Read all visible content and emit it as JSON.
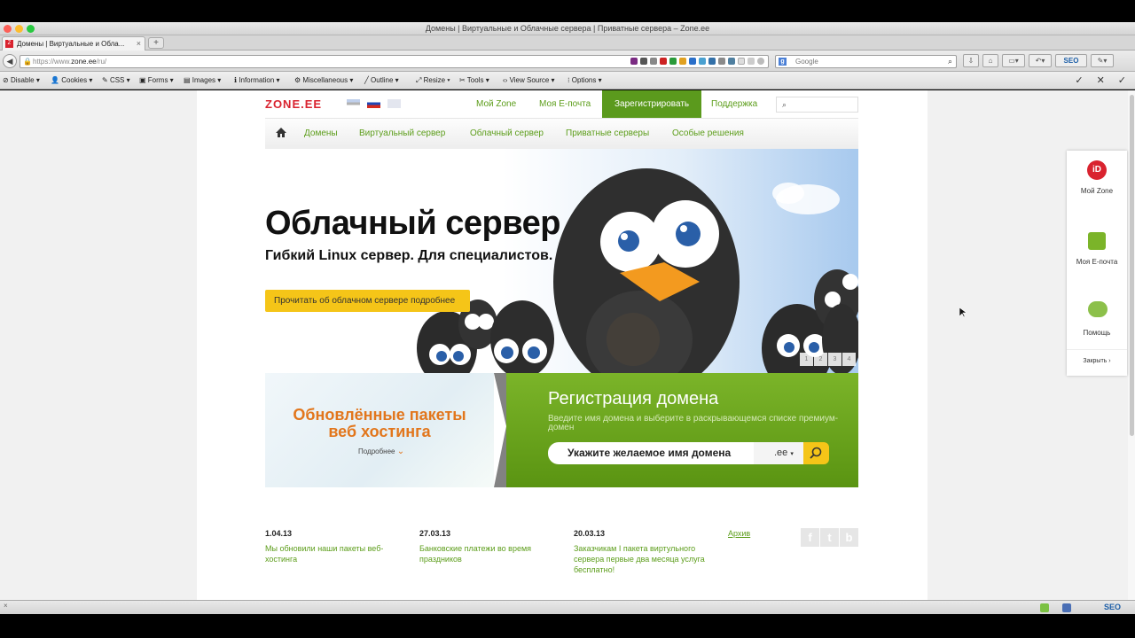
{
  "browser": {
    "window_title": "Домены | Виртуальные и Облачные сервера | Приватные сервера – Zone.ee",
    "tab_title": "Домены | Виртуальные и Обла...",
    "new_tab": "+",
    "url_prefix": "https://www.",
    "url_host": "zone.ee",
    "url_path": "/ru/",
    "search_placeholder": "Google",
    "seo_badge": "SEO"
  },
  "dev_toolbar": {
    "items": [
      "Disable",
      "Cookies",
      "CSS",
      "Forms",
      "Images",
      "Information",
      "Miscellaneous",
      "Outline",
      "Resize",
      "Tools",
      "View Source",
      "Options"
    ]
  },
  "site": {
    "logo": "ZONE.EE",
    "top_nav": [
      "Мой Zone",
      "Моя E-почта",
      "Зарегистрировать",
      "Поддержка"
    ],
    "main_menu": [
      "Домены",
      "Виртуальный сервер",
      "Облачный сервер",
      "Приватные серверы",
      "Особые решения"
    ],
    "hero": {
      "title": "Облачный сервер",
      "subtitle": "Гибкий Linux сервер. Для специалистов.",
      "button": "Прочитать об облачном сервере подробнее",
      "slides": [
        "1",
        "2",
        "3",
        "4"
      ]
    },
    "promo": {
      "title_line1": "Обновлённые пакеты",
      "title_line2": "веб хостинга",
      "more": "Подробнее"
    },
    "domain": {
      "title": "Регистрация домена",
      "subtitle": "Введите имя домена и выберите в раскрывающемся списке премиум-домен",
      "input_placeholder": "Укажите желаемое имя домена",
      "tld": ".ee"
    },
    "news": [
      {
        "date": "1.04.13",
        "text": "Мы обновили наши пакеты веб-хостинга"
      },
      {
        "date": "27.03.13",
        "text": "Банковские платежи во время праздников"
      },
      {
        "date": "20.03.13",
        "text": "Заказчикам I пакета виртульного сервера первые два месяца услуга бесплатно!"
      }
    ],
    "archive": "Архив",
    "social": [
      "f",
      "t",
      "b"
    ]
  },
  "side_panel": {
    "items": [
      "Мой Zone",
      "Моя E-почта",
      "Помощь"
    ],
    "close": "Закрыть"
  },
  "colors": {
    "brand_red": "#d9232f",
    "brand_green": "#5b9a1d",
    "accent_yellow": "#f5c518",
    "promo_orange": "#e2761c"
  }
}
